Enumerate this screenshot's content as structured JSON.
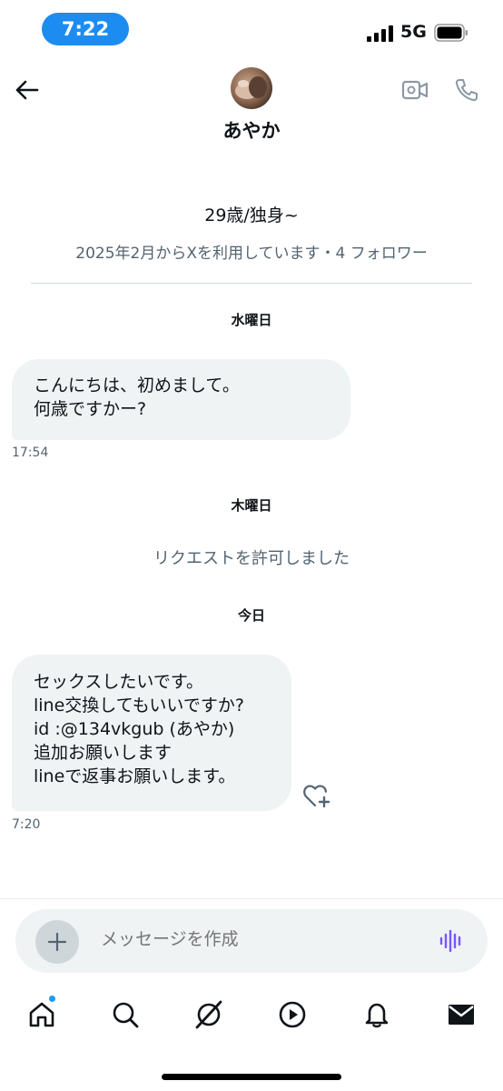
{
  "status_bar": {
    "time": "7:22",
    "network": "5G"
  },
  "header": {
    "name": "あやか"
  },
  "profile": {
    "bio": "29歳/独身~",
    "meta": "2025年2月からXを利用しています・4 フォロワー"
  },
  "conversation": {
    "day1": "水曜日",
    "msg1": {
      "lines": [
        "こんにちは、初めまして。",
        "何歳ですかー?"
      ],
      "time": "17:54"
    },
    "day2": "木曜日",
    "system": "リクエストを許可しました",
    "day3": "今日",
    "msg2": {
      "lines": [
        "セックスしたいです。",
        "line交換してもいいですか?",
        "id :@134vkgub (あやか)",
        "追加お願いします",
        "lineで返事お願いします。"
      ],
      "time": "7:20"
    }
  },
  "composer": {
    "placeholder": "メッセージを作成"
  },
  "colors": {
    "accent": "#1d9bf0",
    "bubble": "#eff3f4",
    "secondary_text": "#536471",
    "voice_icon": "#7856ff"
  },
  "icons": {
    "back": "arrow-left-icon",
    "video": "video-camera-icon",
    "phone": "phone-icon",
    "react": "heart-plus-icon",
    "add": "plus-icon",
    "voice": "voice-wave-icon",
    "tabs": [
      "home-icon",
      "search-icon",
      "grok-icon",
      "video-play-icon",
      "bell-icon",
      "mail-icon"
    ]
  }
}
